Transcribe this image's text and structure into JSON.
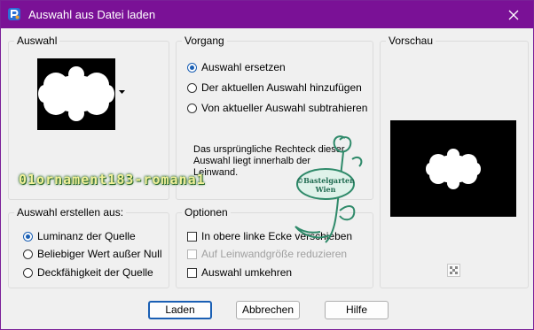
{
  "window": {
    "title": "Auswahl aus Datei laden"
  },
  "auswahl": {
    "label": "Auswahl",
    "selected_shape": "ornament-mask"
  },
  "vorgang": {
    "label": "Vorgang",
    "options": [
      "Auswahl ersetzen",
      "Der aktuellen Auswahl hinzufügen",
      "Von aktueller Auswahl subtrahieren"
    ],
    "selected": 0,
    "info": "Das ursprüngliche Rechteck dieser Auswahl liegt innerhalb der Leinwand."
  },
  "vorschau": {
    "label": "Vorschau"
  },
  "erstellen": {
    "label": "Auswahl erstellen aus:",
    "options": [
      "Luminanz der Quelle",
      "Beliebiger Wert außer Null",
      "Deckfähigkeit der Quelle"
    ],
    "selected": 0
  },
  "optionen": {
    "label": "Optionen",
    "checks": [
      {
        "label": "In obere linke Ecke verschieben",
        "checked": false,
        "disabled": false
      },
      {
        "label": "Auf Leinwandgröße reduzieren",
        "checked": false,
        "disabled": true
      },
      {
        "label": "Auswahl umkehren",
        "checked": false,
        "disabled": false
      }
    ]
  },
  "buttons": {
    "load": "Laden",
    "cancel": "Abbrechen",
    "help": "Hilfe"
  },
  "watermark": {
    "text": "01ornament183-romana1",
    "logo_text_1": "©Bastelgarten",
    "logo_text_2": "Wien"
  },
  "colors": {
    "titlebar": "#7a1196",
    "accent": "#1a5fb4",
    "watermark": "#f1f09a",
    "logo": "#2f8a6a"
  }
}
